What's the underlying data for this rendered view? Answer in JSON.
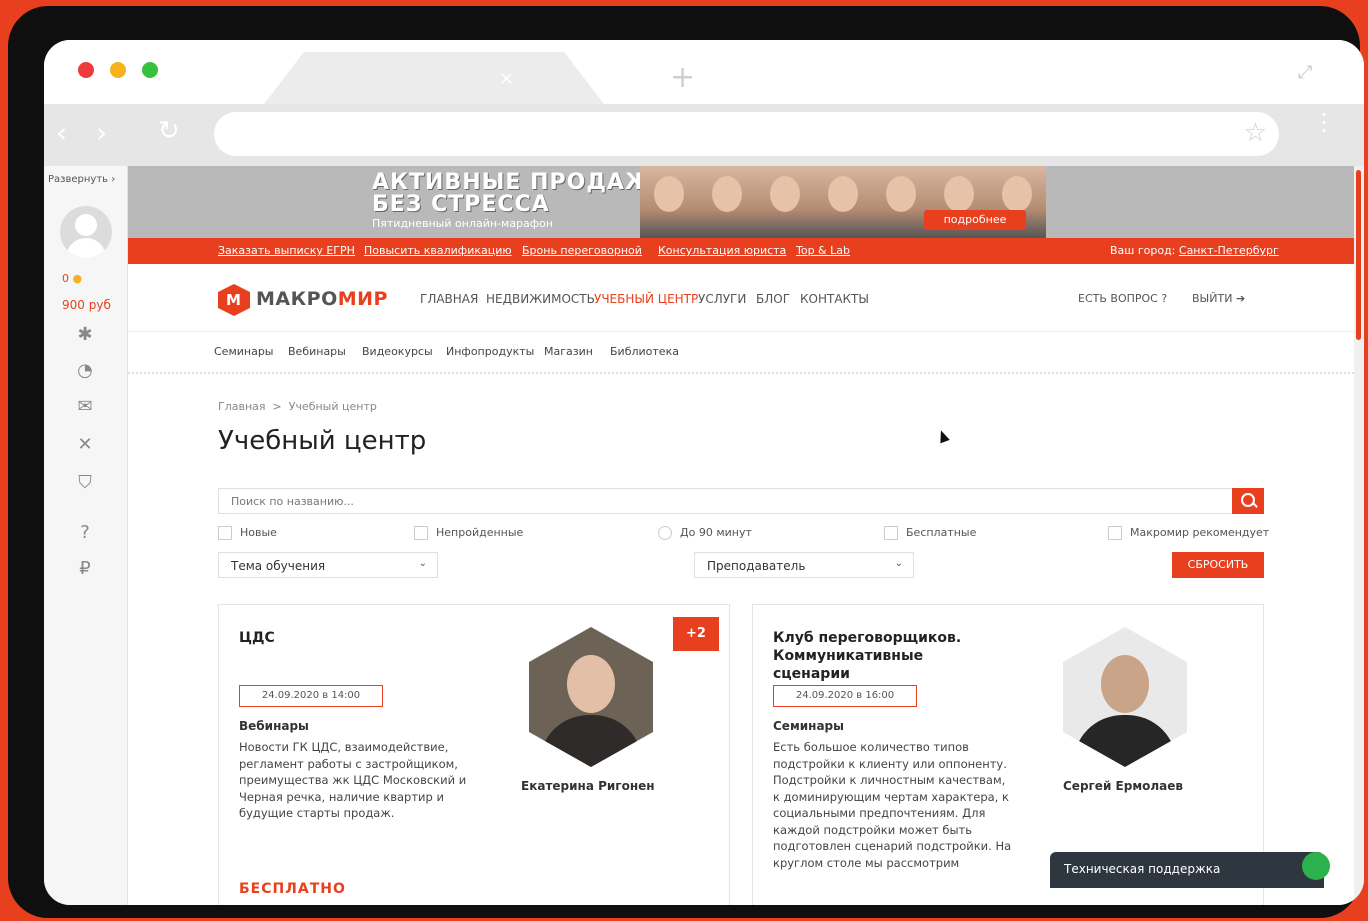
{
  "colors": {
    "accent": "#e8401f",
    "background": "#e8401f",
    "support_bg": "#2e3640",
    "support_green": "#2bb24c"
  },
  "browser": {
    "tab_close_icon": "×",
    "new_tab_icon": "+",
    "resize_icon": "⤢",
    "back_icon": "‹",
    "forward_icon": "›",
    "reload_icon": "↻",
    "star_icon": "☆",
    "menu_icon": "⋮",
    "url": ""
  },
  "sidebar": {
    "expand_label": "Развернуть",
    "expand_chevron": "›",
    "coins": "0",
    "money": "900 руб",
    "icons": [
      "gear-icon",
      "history-icon",
      "chat-icon",
      "tools-icon",
      "shield-icon",
      "help-icon",
      "ruble-icon"
    ]
  },
  "banner": {
    "line1": "АКТИВНЫЕ ПРОДАЖИ",
    "line2": "БЕЗ СТРЕССА",
    "line3": "Пятидневный онлайн-марафон",
    "button": "подробнее"
  },
  "topbar": {
    "links": [
      "Заказать выписку ЕГРН",
      "Повысить квалификацию",
      "Бронь переговорной",
      "Консультация юриста",
      "Top & Lab"
    ],
    "city_label": "Ваш город:",
    "city": "Санкт-Петербург"
  },
  "header": {
    "logo_part1": "МАКРО",
    "logo_part2": "МИР",
    "nav": [
      "ГЛАВНАЯ",
      "НЕДВИЖИМОСТЬ",
      "УЧЕБНЫЙ ЦЕНТР",
      "УСЛУГИ",
      "БЛОГ",
      "КОНТАКТЫ"
    ],
    "question": "ЕСТЬ ВОПРОС",
    "question_icon": "?",
    "logout": "ВЫЙТИ",
    "logout_icon": "➔"
  },
  "subnav": [
    "Семинары",
    "Вебинары",
    "Видеокурсы",
    "Инфопродукты",
    "Магазин",
    "Библиотека"
  ],
  "breadcrumb": {
    "home": "Главная",
    "sep": ">",
    "current": "Учебный центр"
  },
  "page_title": "Учебный центр",
  "search": {
    "placeholder": "Поиск по названию..."
  },
  "filters": {
    "checkboxes": [
      "Новые",
      "Непройденные",
      "До 90 минут",
      "Бесплатные",
      "Макромир рекомендует"
    ],
    "topic": "Тема обучения",
    "teacher": "Преподаватель",
    "chevron": "⌄",
    "reset": "СБРОСИТЬ"
  },
  "cards": [
    {
      "title": "ЦДС",
      "date": "24.09.2020 в 14:00",
      "category": "Вебинары",
      "description": "Новости ГК ЦДС, взаимодействие, регламент работы с застройщиком, преимущества жк ЦДС Московский и Черная речка, наличие квартир и будущие старты продаж.",
      "teacher": "Екатерина Ригонен",
      "badge": "+2",
      "price": "БЕСПЛАТНО"
    },
    {
      "title": "Клуб переговорщиков. Коммуникативные сценарии",
      "date": "24.09.2020 в 16:00",
      "category": "Семинары",
      "description": "Есть большое количество типов подстройки к клиенту или оппоненту. Подстройки к личностным качествам, к доминирующим чертам характера, к социальными предпочтениям. Для каждой подстройки может быть подготовлен сценарий подстройки. На круглом столе мы рассмотрим",
      "teacher": "Сергей Ермолаев"
    }
  ],
  "support": {
    "label": "Техническая поддержка"
  }
}
